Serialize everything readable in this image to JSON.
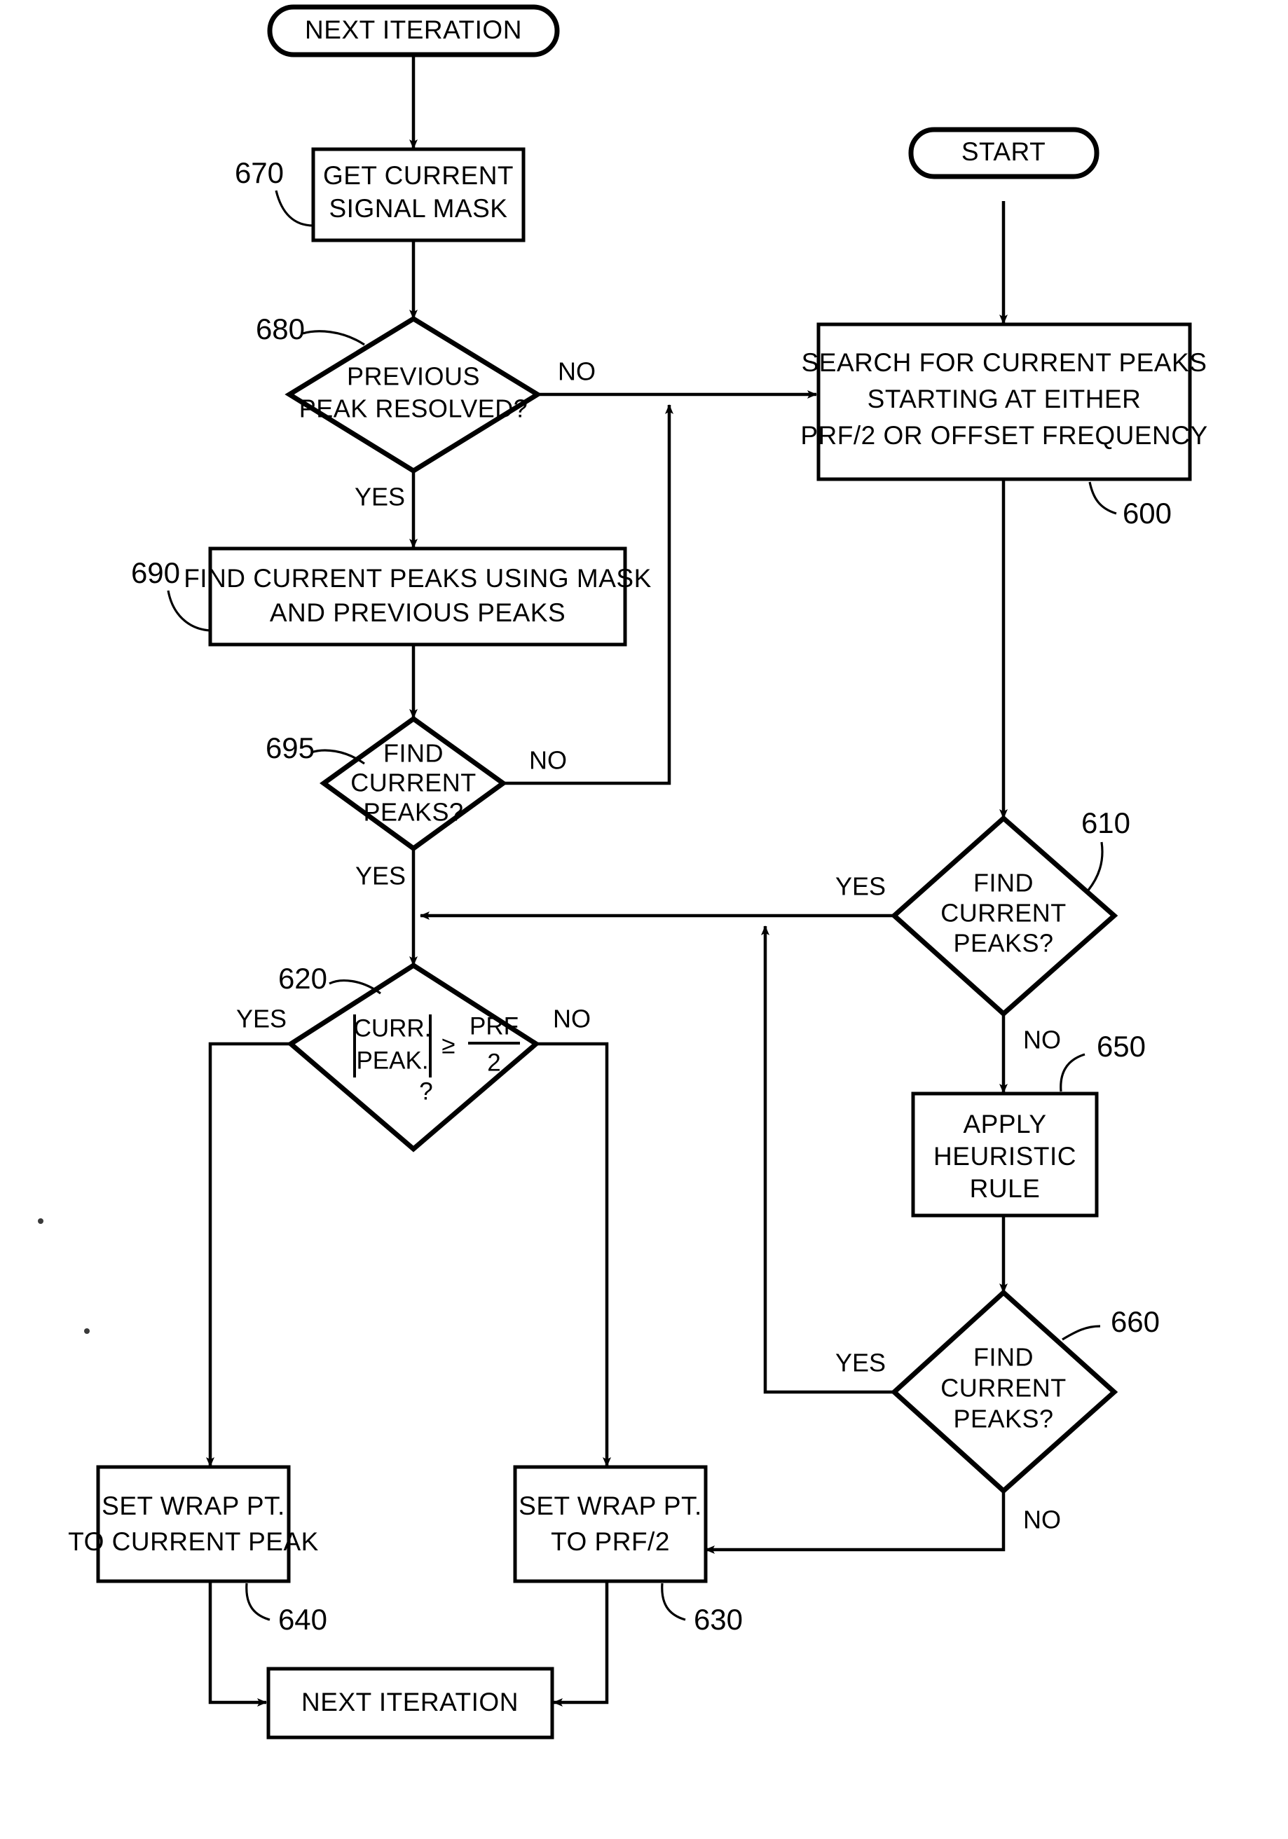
{
  "figure": {
    "type": "flowchart",
    "title": "",
    "background_color": "#ffffff",
    "line_color": "#000000"
  },
  "nodes": {
    "next_iteration_top": {
      "label": "NEXT ITERATION",
      "shape": "terminator",
      "ref": ""
    },
    "get_current_signal_mask": {
      "line1": "GET CURRENT",
      "line2": "SIGNAL MASK",
      "shape": "process",
      "ref": "670"
    },
    "previous_peak_resolved": {
      "line1": "PREVIOUS",
      "line2": "PEAK RESOLVED?",
      "shape": "decision",
      "ref": "680"
    },
    "find_current_peaks_using_mask": {
      "line1": "FIND CURRENT PEAKS USING MASK",
      "line2": "AND PREVIOUS PEAKS",
      "shape": "process",
      "ref": "690"
    },
    "find_current_peaks_695": {
      "line1": "FIND",
      "line2": "CURRENT",
      "line3": "PEAKS?",
      "shape": "decision",
      "ref": "695"
    },
    "start": {
      "label": "START",
      "shape": "terminator",
      "ref": ""
    },
    "search_for_current_peaks": {
      "line1": "SEARCH FOR CURRENT PEAKS",
      "line2": "STARTING AT EITHER",
      "line3": "PRF/2 OR OFFSET FREQUENCY",
      "shape": "process",
      "ref": "600"
    },
    "find_current_peaks_610": {
      "line1": "FIND",
      "line2": "CURRENT",
      "line3": "PEAKS?",
      "shape": "decision",
      "ref": "610"
    },
    "apply_heuristic_rule": {
      "line1": "APPLY",
      "line2": "HEURISTIC",
      "line3": "RULE",
      "shape": "process",
      "ref": "650"
    },
    "find_current_peaks_660": {
      "line1": "FIND",
      "line2": "CURRENT",
      "line3": "PEAKS?",
      "shape": "decision",
      "ref": "660"
    },
    "curr_peak_compare": {
      "numerator": "CURR.",
      "denominator": "PEAK.",
      "operator": "≥",
      "frac_top": "PRF",
      "frac_bottom": "2",
      "question": "?",
      "shape": "decision",
      "ref": "620"
    },
    "set_wrap_pt_current_peak": {
      "line1": "SET WRAP PT.",
      "line2": "TO CURRENT PEAK",
      "shape": "process",
      "ref": "640"
    },
    "set_wrap_pt_prf2": {
      "line1": "SET WRAP PT.",
      "line2": "TO PRF/2",
      "shape": "process",
      "ref": "630"
    },
    "next_iteration_bottom": {
      "label": "NEXT ITERATION",
      "shape": "process",
      "ref": ""
    }
  },
  "edge_labels": {
    "previous_peak_resolved_no": "NO",
    "previous_peak_resolved_yes": "YES",
    "find_695_no": "NO",
    "find_695_yes": "YES",
    "find_610_yes": "YES",
    "find_610_no": "NO",
    "find_660_yes": "YES",
    "find_660_no": "NO",
    "compare_yes": "YES",
    "compare_no": "NO"
  },
  "reference_numbers": [
    "670",
    "680",
    "690",
    "695",
    "600",
    "610",
    "650",
    "660",
    "620",
    "640",
    "630"
  ]
}
